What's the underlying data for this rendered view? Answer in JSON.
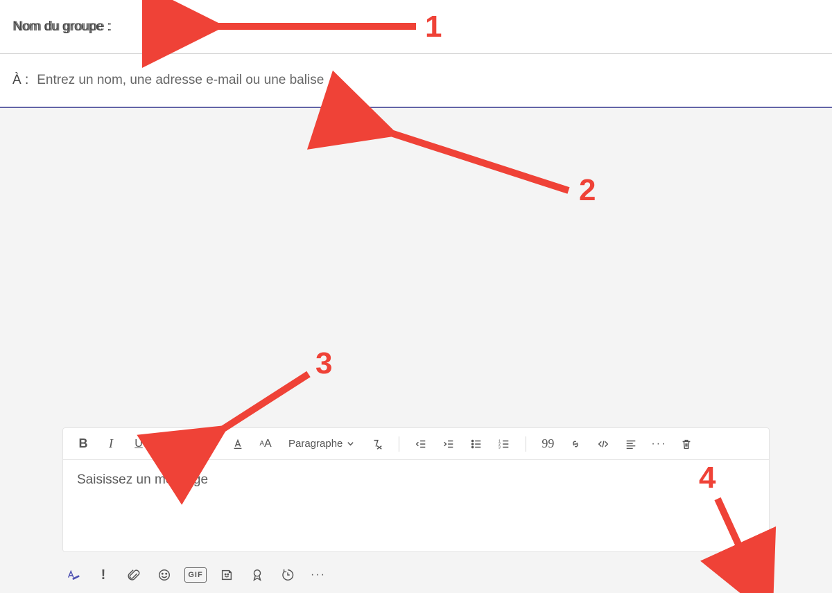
{
  "header": {
    "group_name_label": "Nom du groupe :"
  },
  "recipients": {
    "to_label": "À :",
    "placeholder": "Entrez un nom, une adresse e-mail ou une balise"
  },
  "composer": {
    "paragraph_dropdown": "Paragraphe",
    "message_placeholder": "Saisissez un message",
    "gif_label": "GIF"
  },
  "annotations": {
    "n1": "1",
    "n2": "2",
    "n3": "3",
    "n4": "4"
  },
  "colors": {
    "accent": "#6264a7",
    "annotation": "#ef4237"
  }
}
